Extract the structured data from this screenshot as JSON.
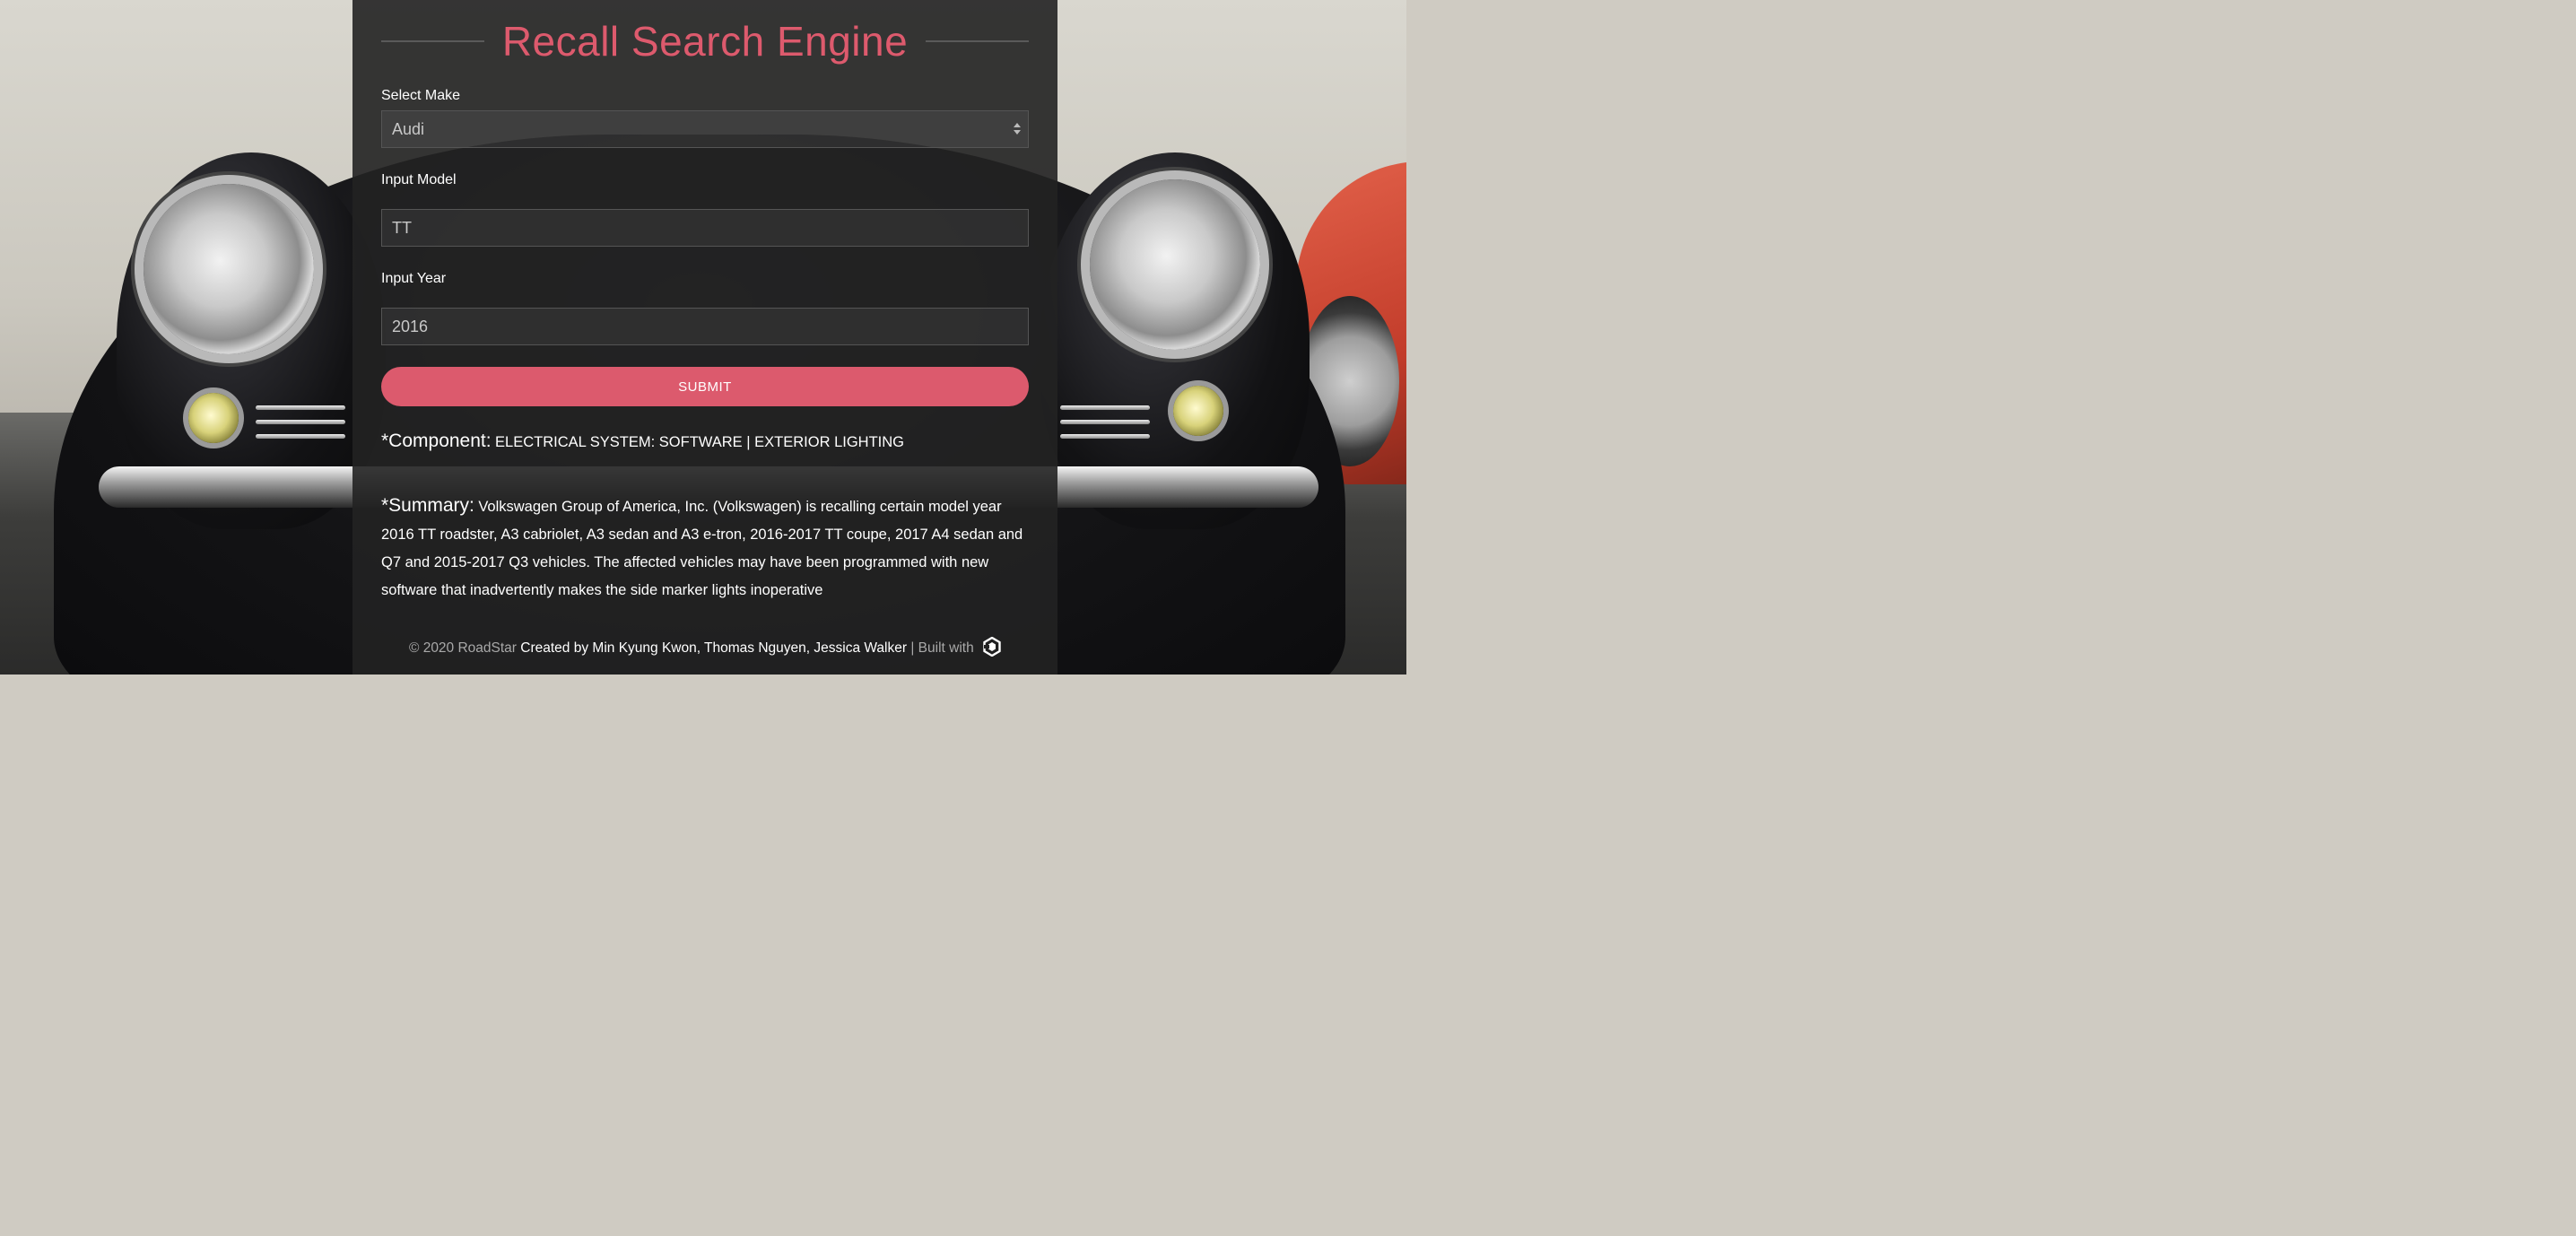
{
  "page": {
    "title": "Recall Search Engine"
  },
  "form": {
    "make_label": "Select Make",
    "make_value": "Audi",
    "model_label": "Input Model",
    "model_value": "TT",
    "year_label": "Input Year",
    "year_value": "2016",
    "submit_label": "SUBMIT"
  },
  "result": {
    "component_key": "*Component:",
    "component_value": "ELECTRICAL SYSTEM: SOFTWARE | EXTERIOR LIGHTING",
    "summary_key": "*Summary:",
    "summary_value": "Volkswagen Group of America, Inc. (Volkswagen) is recalling certain model year 2016 TT roadster, A3 cabriolet, A3 sedan and A3 e-tron, 2016-2017 TT coupe, 2017 A4 sedan and Q7 and 2015-2017 Q3 vehicles. The affected vehicles may have been programmed with new software that inadvertently makes the side marker lights inoperative"
  },
  "footer": {
    "copyright": "© 2020 RoadStar",
    "credits": "Created by Min Kyung Kwon, Thomas Nguyen, Jessica Walker",
    "built_with": "| Built with",
    "builder_icon": "hexagon-logo-icon"
  },
  "colors": {
    "accent": "#dc5a6d",
    "panel": "#222222"
  }
}
